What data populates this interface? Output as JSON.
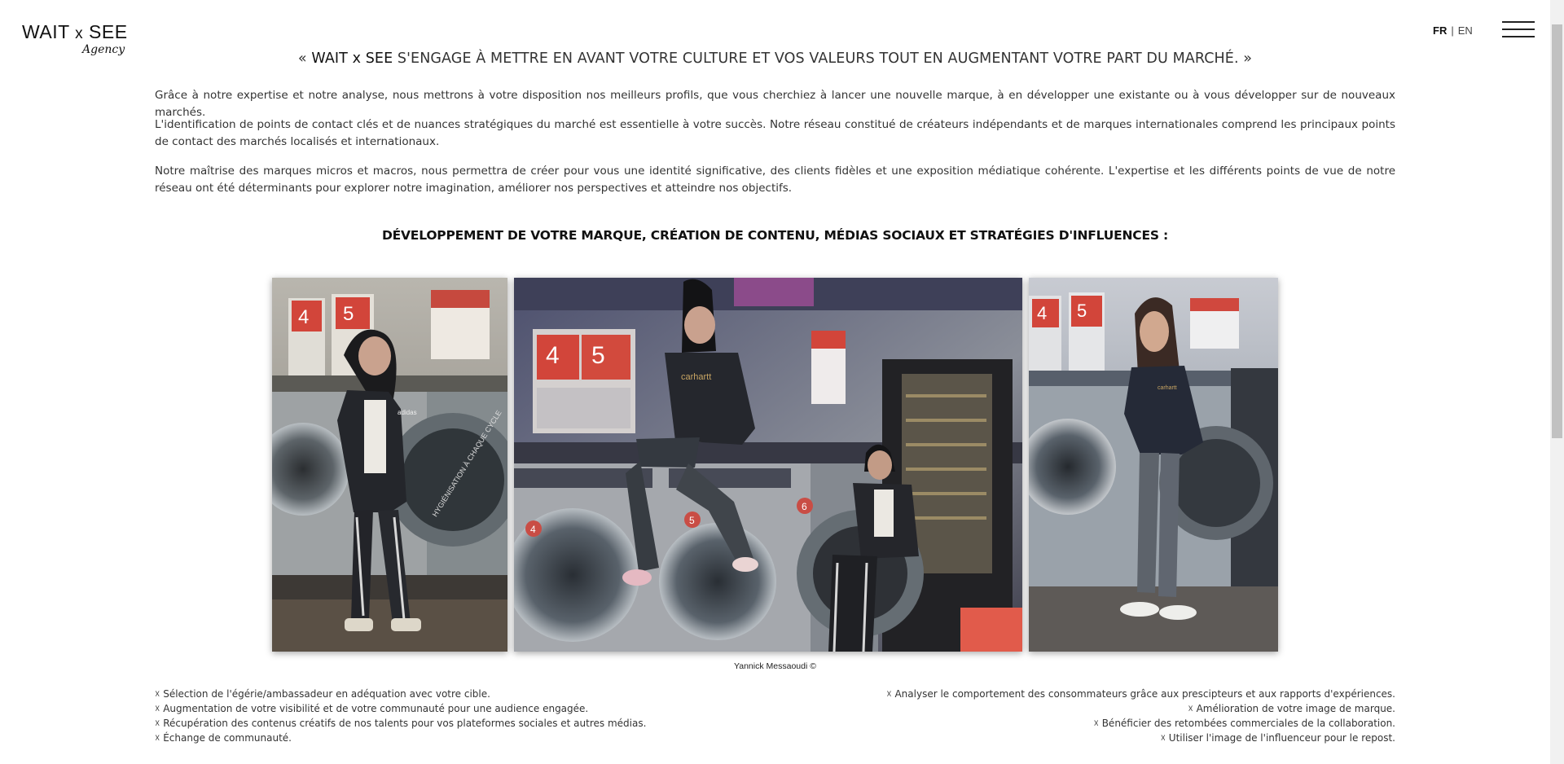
{
  "header": {
    "logo_main": "WAIT",
    "logo_x": "x",
    "logo_main_2": "SEE",
    "logo_sub": "Agency",
    "lang_active": "FR",
    "lang_separator": "|",
    "lang_other": "EN",
    "menu_icon": "hamburger-menu-icon"
  },
  "intro": {
    "quote_open": "« ",
    "brand": "WAIT x SEE",
    "quote_text": " S'ENGAGE À METTRE EN AVANT VOTRE CULTURE ET VOS VALEURS TOUT EN AUGMENTANT VOTRE PART DU MARCHÉ. »",
    "paragraphs": [
      "Grâce à notre expertise et notre analyse, nous mettrons à votre disposition nos meilleurs profils, que vous cherchiez à lancer une nouvelle marque, à en développer une existante ou à vous développer sur de nouveaux marchés.",
      "L'identification de points de contact clés et de nuances stratégiques du marché est essentielle à votre succès. Notre réseau constitué de créateurs indépendants et de marques internationales comprend les principaux points de contact des marchés localisés et internationaux.",
      "Notre maîtrise des marques micros et macros, nous permettra de créer pour vous une identité significative, des clients fidèles et une exposition médiatique cohérente. L'expertise et les différents points de vue de notre réseau ont été déterminants pour explorer notre imagination, améliorer nos perspectives et atteindre nos objectifs."
    ]
  },
  "services": {
    "title": "DÉVELOPPEMENT DE VOTRE MARQUE, CRÉATION DE CONTENU, MÉDIAS SOCIAUX ET STRATÉGIES D'INFLUENCES :",
    "photo_credit": "Yannick Messaoudi ©",
    "left_items": [
      "☓ Sélection de l'égérie/ambassadeur en adéquation avec votre cible.",
      "☓ Augmentation de votre visibilité et de votre communauté pour une audience engagée.",
      "☓ Récupération des contenus créatifs de nos talents pour vos plateformes sociales et autres médias.",
      "☓ Échange de communauté."
    ],
    "right_items": [
      "☓ Analyser le comportement des consommateurs grâce aux prescipteurs et aux rapports d'expériences.",
      "☓ Amélioration de votre image de marque.",
      "☓ Bénéficier des retombées commerciales de la collaboration.",
      "☓ Utiliser l'image de l'influenceur pour le repost."
    ]
  },
  "photo_text": {
    "sign_1": "4",
    "sign_2": "5",
    "adidas": "adidas",
    "carhartt": "carhartt",
    "drum": "HYGIÉNISATION À CHAQUE CYCLE",
    "machine_4": "4",
    "machine_5": "5",
    "machine_6": "6"
  },
  "colors": {
    "text": "#333333",
    "heading": "#111111",
    "laundry_red": "#d2453a",
    "scrollbar_thumb": "#c1c1c1"
  }
}
